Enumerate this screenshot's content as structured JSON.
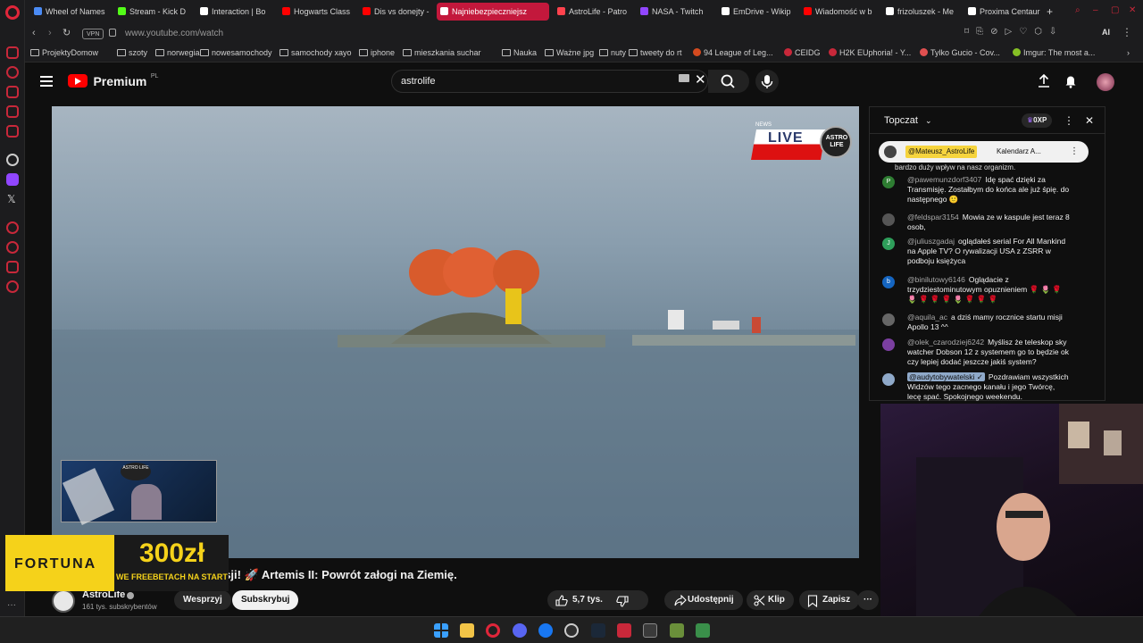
{
  "browser": {
    "tabs": [
      {
        "label": "Wheel of Names",
        "color": "#4b8bf5"
      },
      {
        "label": "Stream - Kick D",
        "color": "#53fc18"
      },
      {
        "label": "Interaction | Bo",
        "color": "#ffffff"
      },
      {
        "label": "Hogwarts Class",
        "color": "#ff0000"
      },
      {
        "label": "Dis vs donejty -",
        "color": "#ff0000"
      },
      {
        "label": "Najniebezpieczniejsz",
        "color": "#ffffff"
      },
      {
        "label": "AstroLife - Patro",
        "color": "#ff424d"
      },
      {
        "label": "NASA - Twitch",
        "color": "#9146ff"
      },
      {
        "label": "EmDrive - Wikip",
        "color": "#ffffff"
      },
      {
        "label": "Wiadomość w b",
        "color": "#ff0000"
      },
      {
        "label": "frizoluszek - Me",
        "color": "#ffffff"
      },
      {
        "label": "Proxima Centaur",
        "color": "#ffffff"
      }
    ],
    "new_tab": "+",
    "vpn_label": "VPN",
    "url": "www.youtube.com/watch",
    "ai_label": "AI",
    "bookmarks": [
      {
        "label": "ProjektyDomow",
        "type": "folder"
      },
      {
        "label": "szoty",
        "type": "folder"
      },
      {
        "label": "norwegia",
        "type": "folder"
      },
      {
        "label": "nowesamochody",
        "type": "folder"
      },
      {
        "label": "samochody xayo",
        "type": "folder"
      },
      {
        "label": "iphone",
        "type": "folder"
      },
      {
        "label": "mieszkania suchar",
        "type": "folder"
      },
      {
        "label": "Nauka",
        "type": "folder"
      },
      {
        "label": "Ważne jpg",
        "type": "folder"
      },
      {
        "label": "nuty",
        "type": "folder"
      },
      {
        "label": "tweety do rt",
        "type": "folder"
      },
      {
        "label": "94 League of Leg...",
        "type": "site"
      },
      {
        "label": "CEIDG",
        "type": "site"
      },
      {
        "label": "H2K EUphoria! - Y...",
        "type": "site"
      },
      {
        "label": "Tylko Gucio - Cov...",
        "type": "site"
      },
      {
        "label": "Imgur: The most a...",
        "type": "site"
      }
    ]
  },
  "youtube": {
    "logo_text": "Premium",
    "logo_region": "PL",
    "search_value": "astrolife",
    "video": {
      "live_label": "LIVE",
      "live_brand": "ASTRO LIFE",
      "live_brand_small": "NEWS",
      "title": "misji! 🚀 Artemis II: Powrót załogi na Ziemię.",
      "channel": "AstroLife",
      "subscribers": "161 tys. subskrybentów",
      "support_label": "Wesprzyj",
      "subscribe_label": "Subskrybuj",
      "likes": "5,7 tys.",
      "share_label": "Udostępnij",
      "clip_label": "Klip",
      "save_label": "Zapisz"
    },
    "chat": {
      "header": "Topczat",
      "xp": "0XP",
      "pinned_author": "@Mateusz_AstroLife",
      "pinned_text": "Kalendarz A...",
      "prev_tail": "bardzo duży wpływ na nasz organizm.",
      "messages": [
        {
          "author": "@pawemunzdorf3407",
          "text": "Idę spać dzięki za Transmisję. Zostałbym do końca ale już śpię. do następnego 🙂",
          "initial": "P",
          "color": "#2e7d32"
        },
        {
          "author": "@feldspar3154",
          "text": "Mowia ze w kaspule jest teraz 8 osob,",
          "initial": "",
          "color": "#555555"
        },
        {
          "author": "@juliuszgadaj",
          "text": "oglądałeś serial For All Mankind na Apple TV? O rywalizacji USA z ZSRR w podboju księżyca",
          "initial": "J",
          "color": "#2e9e5a"
        },
        {
          "author": "@binilutowy6146",
          "text": "Oglądacie z trzydziestominutowym opuznieniem 🌹 🌷 🌹 🌷 🌹 🌹 🌹 🌷 🌹 🌹 🌹",
          "initial": "b",
          "color": "#1565c0"
        },
        {
          "author": "@aquila_ac",
          "text": "a dziś mamy rocznice startu misji Apollo 13 ^^",
          "initial": "",
          "color": "#666666"
        },
        {
          "author": "@olek_czarodziej6242",
          "text": "Myślisz że teleskop sky watcher Dobson 12 z systemem go to będzie ok czy lepiej dodać jeszcze jakiś system?",
          "initial": "",
          "color": "#7b3fa0"
        },
        {
          "author": "@audytobywatelski ✓",
          "text": "Pozdrawiam wszystkich Widzów tego zacnego kanału i jego Twórcę, lecę spać. Spokojnego weekendu.",
          "initial": "",
          "color": "#8fa9c9"
        }
      ]
    },
    "ad": {
      "brand": "FORTUNA",
      "amount": "300zł",
      "tagline": "WE FREEBETACH NA START"
    },
    "overlay_badge": "ASTRO LIFE"
  },
  "colors": {
    "brand_red": "#ff0000",
    "opera_red": "#c3183c",
    "fortuna_yellow": "#f5d21a"
  }
}
